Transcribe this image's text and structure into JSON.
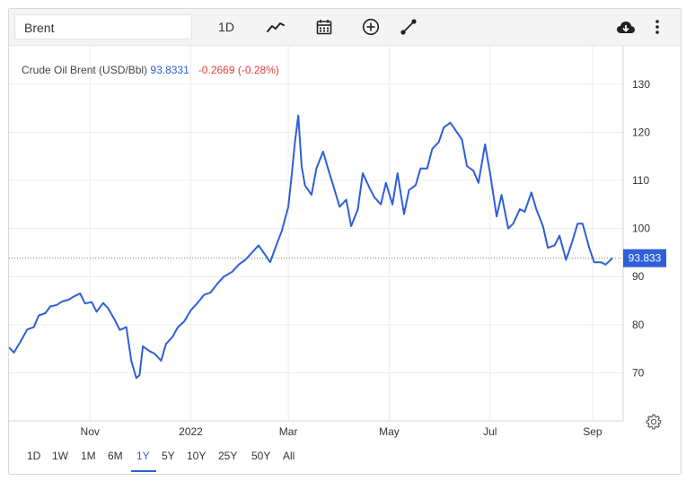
{
  "toolbar": {
    "symbol": "Brent",
    "interval": "1D",
    "icons": [
      "line-chart-icon",
      "calendar-icon",
      "add-circle-icon",
      "draw-line-icon",
      "cloud-download-icon",
      "more-vertical-icon"
    ]
  },
  "legend": {
    "name": "Crude Oil Brent (USD/Bbl)",
    "last": "93.8331",
    "change": "-0.2669 (-0.28%)"
  },
  "price_tag": "93.833",
  "ranges": [
    "1D",
    "1W",
    "1M",
    "6M",
    "1Y",
    "5Y",
    "10Y",
    "25Y",
    "50Y",
    "All"
  ],
  "active_range": "1Y",
  "colors": {
    "line": "#2d5fd8",
    "change_down": "#e0403a",
    "grid": "#ececec"
  },
  "chart_data": {
    "type": "line",
    "title": "Crude Oil Brent (USD/Bbl)",
    "xlabel": "",
    "ylabel": "",
    "ylim": [
      60,
      138
    ],
    "yticks": [
      70,
      80,
      90,
      100,
      110,
      120,
      130
    ],
    "x_tick_labels": [
      {
        "date": "2021-11-01",
        "label": "Nov"
      },
      {
        "date": "2022-01-01",
        "label": "2022"
      },
      {
        "date": "2022-03-01",
        "label": "Mar"
      },
      {
        "date": "2022-05-01",
        "label": "May"
      },
      {
        "date": "2022-07-01",
        "label": "Jul"
      },
      {
        "date": "2022-09-01",
        "label": "Sep"
      }
    ],
    "grid": true,
    "last_value": 93.833,
    "series": [
      {
        "x": [
          "2021-09-13",
          "2021-09-16",
          "2021-09-20",
          "2021-09-24",
          "2021-09-28",
          "2021-10-01",
          "2021-10-05",
          "2021-10-08",
          "2021-10-12",
          "2021-10-15",
          "2021-10-19",
          "2021-10-22",
          "2021-10-26",
          "2021-10-29",
          "2021-11-02",
          "2021-11-05",
          "2021-11-09",
          "2021-11-12",
          "2021-11-16",
          "2021-11-19",
          "2021-11-23",
          "2021-11-26",
          "2021-11-29",
          "2021-12-01",
          "2021-12-03",
          "2021-12-07",
          "2021-12-10",
          "2021-12-14",
          "2021-12-17",
          "2021-12-21",
          "2021-12-24",
          "2021-12-28",
          "2022-01-01",
          "2022-01-05",
          "2022-01-09",
          "2022-01-13",
          "2022-01-17",
          "2022-01-21",
          "2022-01-26",
          "2022-01-30",
          "2022-02-03",
          "2022-02-07",
          "2022-02-11",
          "2022-02-15",
          "2022-02-18",
          "2022-02-22",
          "2022-02-25",
          "2022-03-01",
          "2022-03-03",
          "2022-03-05",
          "2022-03-07",
          "2022-03-09",
          "2022-03-11",
          "2022-03-15",
          "2022-03-18",
          "2022-03-22",
          "2022-03-25",
          "2022-03-29",
          "2022-04-01",
          "2022-04-05",
          "2022-04-08",
          "2022-04-12",
          "2022-04-15",
          "2022-04-19",
          "2022-04-22",
          "2022-04-26",
          "2022-04-29",
          "2022-05-03",
          "2022-05-06",
          "2022-05-10",
          "2022-05-13",
          "2022-05-17",
          "2022-05-20",
          "2022-05-24",
          "2022-05-27",
          "2022-05-31",
          "2022-06-03",
          "2022-06-07",
          "2022-06-10",
          "2022-06-14",
          "2022-06-17",
          "2022-06-21",
          "2022-06-24",
          "2022-06-28",
          "2022-07-01",
          "2022-07-05",
          "2022-07-08",
          "2022-07-12",
          "2022-07-15",
          "2022-07-19",
          "2022-07-22",
          "2022-07-26",
          "2022-07-29",
          "2022-08-02",
          "2022-08-05",
          "2022-08-09",
          "2022-08-12",
          "2022-08-16",
          "2022-08-19",
          "2022-08-23",
          "2022-08-26",
          "2022-08-30",
          "2022-09-02",
          "2022-09-06",
          "2022-09-09",
          "2022-09-13"
        ],
        "values": [
          75.3,
          74.2,
          76.5,
          79.0,
          79.5,
          81.9,
          82.4,
          83.8,
          84.1,
          84.8,
          85.2,
          85.8,
          86.5,
          84.4,
          84.7,
          82.7,
          84.5,
          83.4,
          81.0,
          78.9,
          79.5,
          72.5,
          68.9,
          69.5,
          75.5,
          74.5,
          74.0,
          72.5,
          76.0,
          77.5,
          79.4,
          80.7,
          83.0,
          84.5,
          86.2,
          86.7,
          88.5,
          90.0,
          91.0,
          92.5,
          93.5,
          95.0,
          96.5,
          94.5,
          93.0,
          96.8,
          99.5,
          104.5,
          111.0,
          118.0,
          123.5,
          113.0,
          109.0,
          107.0,
          112.5,
          116.0,
          112.5,
          108.0,
          104.5,
          106.0,
          100.5,
          104.0,
          111.5,
          108.5,
          106.5,
          105.0,
          109.5,
          105.0,
          111.5,
          103.0,
          108.0,
          109.0,
          112.5,
          112.5,
          116.5,
          118.0,
          121.0,
          122.0,
          120.5,
          118.5,
          113.0,
          112.0,
          109.5,
          117.5,
          111.5,
          102.5,
          107.0,
          100.0,
          101.0,
          104.0,
          103.5,
          107.5,
          104.0,
          100.5,
          96.0,
          96.5,
          98.5,
          93.5,
          96.5,
          101.0,
          101.0,
          96.0,
          93.0,
          93.0,
          92.5,
          93.83
        ]
      }
    ]
  }
}
